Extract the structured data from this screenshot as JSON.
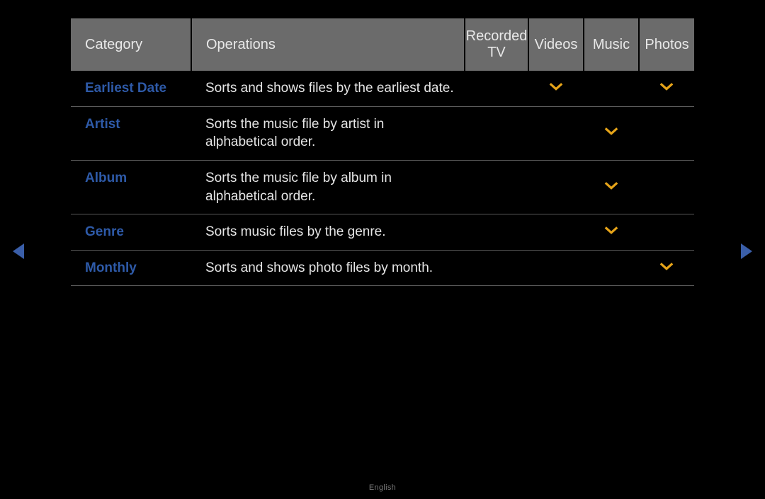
{
  "headers": {
    "category": "Category",
    "operations": "Operations",
    "recorded_tv": "Recorded TV",
    "videos": "Videos",
    "music": "Music",
    "photos": "Photos"
  },
  "rows": [
    {
      "category": "Earliest Date",
      "operation": "Sorts and shows files by the earliest date.",
      "recorded_tv": false,
      "videos": true,
      "music": false,
      "photos": true
    },
    {
      "category": "Artist",
      "operation": "Sorts the music file by artist in alphabetical order.",
      "recorded_tv": false,
      "videos": false,
      "music": true,
      "photos": false
    },
    {
      "category": "Album",
      "operation": "Sorts the music file by album in alphabetical order.",
      "recorded_tv": false,
      "videos": false,
      "music": true,
      "photos": false
    },
    {
      "category": "Genre",
      "operation": "Sorts music files by the genre.",
      "recorded_tv": false,
      "videos": false,
      "music": true,
      "photos": false
    },
    {
      "category": "Monthly",
      "operation": "Sorts and shows photo files by month.",
      "recorded_tv": false,
      "videos": false,
      "music": false,
      "photos": true
    }
  ],
  "footer": {
    "language": "English"
  }
}
